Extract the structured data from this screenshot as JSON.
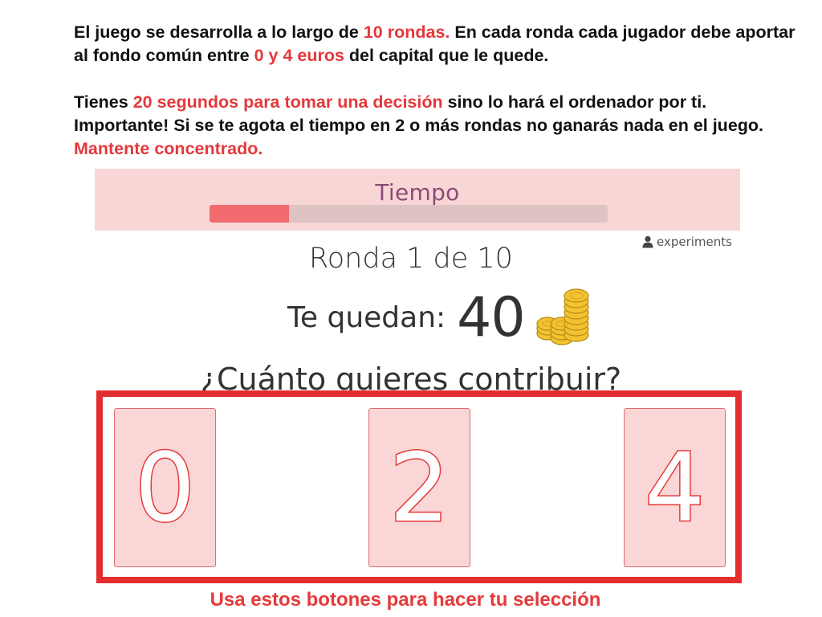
{
  "instructions": {
    "p1": {
      "t1": "El juego se desarrolla a lo largo de ",
      "h1": "10 rondas.",
      "t2": " En cada ronda cada jugador debe aportar al fondo común entre ",
      "h2": "0 y 4 euros",
      "t3": " del capital que le quede."
    },
    "p2": {
      "t1": "Tienes ",
      "h1": "20 segundos para tomar una decisión",
      "t2": " sino lo hará el ordenador por ti. Importante! Si se te agota el tiempo en 2 o más rondas no ganarás nada en el juego. ",
      "h2": "Mantente concentrado."
    }
  },
  "timer": {
    "label": "Tiempo",
    "progress_fraction": 0.2
  },
  "user": {
    "icon": "user-icon",
    "name": "experiments"
  },
  "round": {
    "text": "Ronda 1 de 10"
  },
  "remaining": {
    "label": "Te quedan:",
    "value": "40",
    "icon": "coins-icon"
  },
  "question": "¿Cuánto quieres contribuir?",
  "choices": [
    {
      "label": "0"
    },
    {
      "label": "2"
    },
    {
      "label": "4"
    }
  ],
  "hint": "Usa estos botones para hacer tu selección",
  "colors": {
    "accent_red": "#e53a3a",
    "panel_pink": "#f9d6d6",
    "timer_fill": "#f06a6e",
    "timer_track": "#dfc3c3",
    "timer_label": "#8a4c78"
  }
}
